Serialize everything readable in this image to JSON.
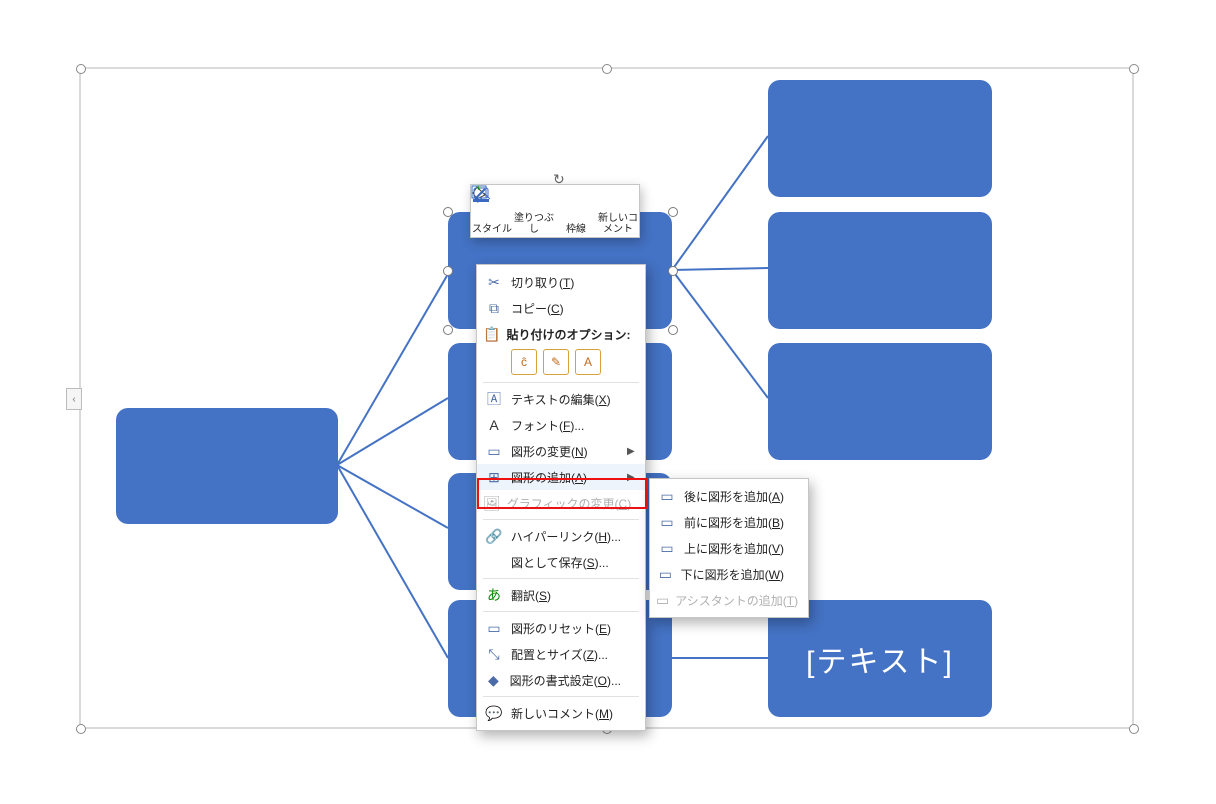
{
  "colors": {
    "shape": "#4472c4",
    "menu_border": "#c6c6c6"
  },
  "placeholder_text": "[テキスト]",
  "mini_toolbar": {
    "style": "スタイル",
    "fill": "塗りつぶし",
    "outline": "枠線",
    "new_comment": "新しいコメント"
  },
  "context_menu": {
    "cut": "切り取り(T)",
    "copy": "コピー(C)",
    "paste_header": "貼り付けのオプション:",
    "edit_text": "テキストの編集(X)",
    "font": "フォント(F)...",
    "change_shape": "図形の変更(N)",
    "add_shape": "図形の追加(A)",
    "change_graphic": "グラフィックの変更(C)",
    "link": "ハイパーリンク(H)...",
    "save_as_pic": "図として保存(S)...",
    "translate": "翻訳(S)",
    "reset_shape": "図形のリセット(E)",
    "size_pos": "配置とサイズ(Z)...",
    "format_shape": "図形の書式設定(O)...",
    "new_comment": "新しいコメント(M)"
  },
  "submenu": {
    "add_after": "後に図形を追加(A)",
    "add_before": "前に図形を追加(B)",
    "add_above": "上に図形を追加(V)",
    "add_below": "下に図形を追加(W)",
    "add_assistant": "アシスタントの追加(T)"
  }
}
